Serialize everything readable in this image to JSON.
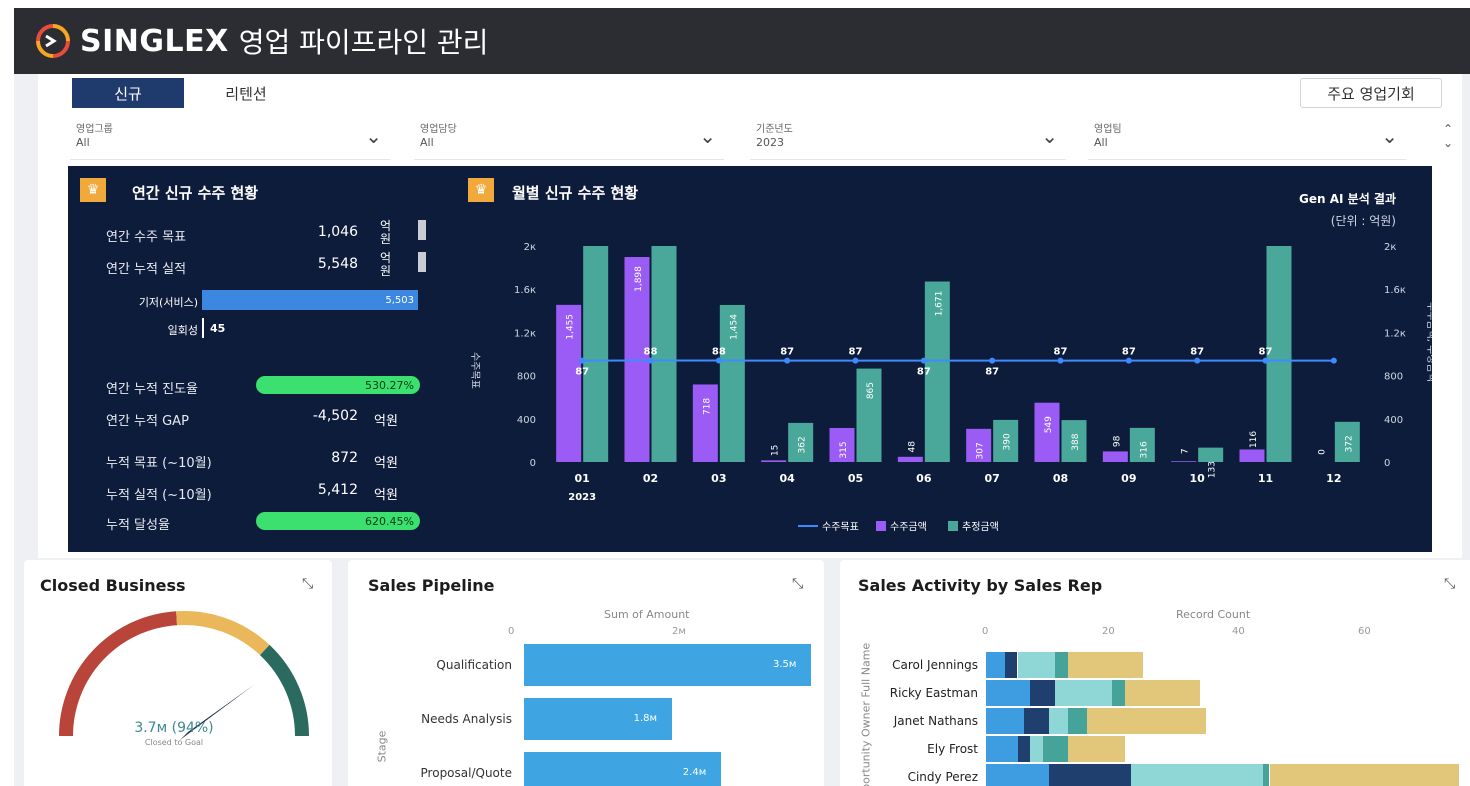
{
  "app": {
    "brand": "SINGLEX",
    "title": "영업 파이프라인 관리"
  },
  "tabs": [
    {
      "label": "신규"
    },
    {
      "label": "리텐션"
    }
  ],
  "key_button": "주요 영업기회",
  "filters": [
    {
      "label": "영업그룹",
      "value": "All"
    },
    {
      "label": "영업담당",
      "value": "All"
    },
    {
      "label": "기준년도",
      "value": "2023"
    },
    {
      "label": "영업팀",
      "value": "All"
    }
  ],
  "annual": {
    "title": "연간 신규 수주 현황",
    "target": {
      "label": "연간 수주 목표",
      "value": "1,046",
      "unit": "억원"
    },
    "actual": {
      "label": "연간 누적 실적",
      "value": "5,548",
      "unit": "억원"
    },
    "breakdown": [
      {
        "label": "기저(서비스)",
        "value": "5,503",
        "fraction": 0.992
      },
      {
        "label": "일회성",
        "value": "45",
        "fraction": 0.0
      }
    ],
    "progress": {
      "label": "연간 누적 진도율",
      "value": "530.27%"
    },
    "gap": {
      "label": "연간 누적 GAP",
      "value": "-4,502",
      "unit": "억원"
    },
    "cum_target": {
      "label": "누적 목표 (~10월)",
      "value": "872",
      "unit": "억원"
    },
    "cum_actual": {
      "label": "누적 실적 (~10월)",
      "value": "5,412",
      "unit": "억원"
    },
    "achievement": {
      "label": "누적 달성율",
      "value": "620.45%"
    }
  },
  "monthly": {
    "title": "월별 신규 수주 현황",
    "ai_label": "Gen AI 분석 결과",
    "unit_label": "(단위 : 억원)",
    "left_axis_title": "수주목표",
    "right_axis_title": "수주금액, 추정금액",
    "legend": [
      "수주목표",
      "수주금액",
      "추정금액"
    ],
    "colors": {
      "target": "#3d8bff",
      "order": "#9b5cf5",
      "estimate": "#4aa89a"
    }
  },
  "chart_data": {
    "type": "bar",
    "categories": [
      "01",
      "02",
      "03",
      "04",
      "05",
      "06",
      "07",
      "08",
      "09",
      "10",
      "11",
      "12"
    ],
    "x_sublabel": "2023",
    "y_ticks": [
      "2к",
      "1.6к",
      "1.2к",
      "800",
      "400",
      "0"
    ],
    "y_right_ticks": [
      "2к",
      "1.6к",
      "1.2к",
      "800",
      "400",
      "0"
    ],
    "ylim": [
      0,
      2000
    ],
    "series": [
      {
        "name": "수주금액",
        "values": [
          1455,
          1898,
          718,
          15,
          315,
          48,
          307,
          549,
          98,
          7,
          116,
          0
        ],
        "labels": [
          "1,455",
          "1,898",
          "718",
          "15",
          "315",
          "48",
          "307",
          "549",
          "98",
          "7",
          "116",
          "0"
        ]
      },
      {
        "name": "추정금액",
        "values": [
          2000,
          2000,
          1454,
          362,
          865,
          1671,
          390,
          388,
          316,
          133,
          2000,
          372
        ],
        "labels": [
          "",
          "",
          "1,454",
          "362",
          "865",
          "1,671",
          "390",
          "388",
          "316",
          "133",
          "",
          "372"
        ]
      },
      {
        "name": "수주목표",
        "type": "line",
        "values": [
          87,
          88,
          88,
          87,
          87,
          87,
          87,
          87,
          87,
          87,
          87,
          87
        ]
      }
    ]
  },
  "closed_business": {
    "title": "Closed Business",
    "value": "3.7м (94%)",
    "sub": "Closed to Goal",
    "fraction": 0.94
  },
  "pipeline": {
    "title": "Sales Pipeline",
    "axis_title": "Sum of Amount",
    "ticks": [
      "0",
      "2м"
    ],
    "y_title": "Stage",
    "rows": [
      {
        "stage": "Qualification",
        "value": "3.5м",
        "amount": 3.5
      },
      {
        "stage": "Needs Analysis",
        "value": "1.8м",
        "amount": 1.8
      },
      {
        "stage": "Proposal/Quote",
        "value": "2.4м",
        "amount": 2.4
      }
    ]
  },
  "activity": {
    "title": "Sales Activity by Sales Rep",
    "axis_title": "Record Count",
    "ticks": [
      "0",
      "20",
      "40",
      "60"
    ],
    "y_title": "Opportunity Owner Full Name",
    "colors": [
      "#3e9de0",
      "#1f3f6e",
      "#8fd6d6",
      "#46a39a",
      "#e2c77a"
    ],
    "rows": [
      {
        "rep": "Carol Jennings",
        "segments": [
          3,
          2,
          6,
          2,
          12
        ]
      },
      {
        "rep": "Ricky Eastman",
        "segments": [
          7,
          4,
          9,
          2,
          12
        ]
      },
      {
        "rep": "Janet Nathans",
        "segments": [
          6,
          4,
          3,
          3,
          19
        ]
      },
      {
        "rep": "Ely Frost",
        "segments": [
          5,
          2,
          2,
          4,
          9
        ]
      },
      {
        "rep": "Cindy Perez",
        "segments": [
          10,
          13,
          21,
          1,
          30
        ]
      }
    ]
  }
}
